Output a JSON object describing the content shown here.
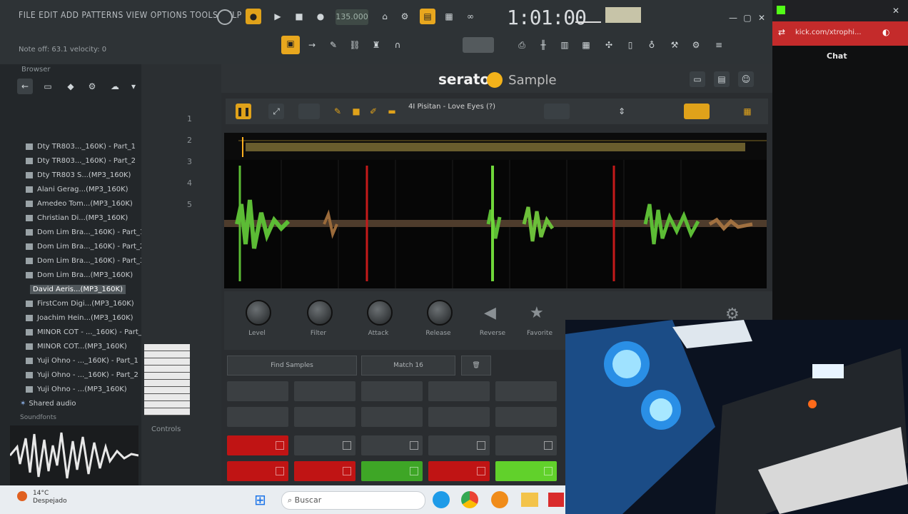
{
  "app": {
    "menu": "FILE EDIT ADD PATTERNS VIEW OPTIONS TOOLS HELP",
    "hint": "Note off: 63.1 velocity: 0",
    "tempo": "135.000",
    "time": "1:01:00"
  },
  "browser": {
    "title": "Browser",
    "items": [
      "Dty TR803..._160K) - Part_1",
      "Dty TR803..._160K) - Part_2",
      "Dty TR803 S...(MP3_160K)",
      "Alani Gerag...(MP3_160K)",
      "Amedeo Tom...(MP3_160K)",
      "Christian Di...(MP3_160K)",
      "Dom Lim Bra..._160K) - Part_1",
      "Dom Lim Bra..._160K) - Part_2",
      "Dom Lim Bra..._160K) - Part_3",
      "Dom Lim Bra...(MP3_160K)",
      "David Aeris...(MP3_160K)",
      "FirstCom Digi...(MP3_160K)",
      "Joachim Hein...(MP3_160K)",
      "MINOR COT - ..._160K) - Part_1",
      "MINOR COT...(MP3_160K)",
      "Yuji Ohno - ..._160K) - Part_1",
      "Yuji Ohno - ..._160K) - Part_2",
      "Yuji Ohno - ...(MP3_160K)"
    ],
    "selected_index": 10,
    "folders": [
      "Shared audio",
      "Soundfonts"
    ]
  },
  "rack": {
    "numbers": [
      "1",
      "2",
      "3",
      "4",
      "5"
    ],
    "controls_label": "Controls"
  },
  "serato": {
    "logo": "serato",
    "logo_sub": "Sample",
    "track": "4I Pisitan - Love Eyes (?)",
    "knob_labels": [
      "Level",
      "Filter",
      "Attack",
      "Release",
      "Reverse",
      "Favorite"
    ],
    "dropdowns": [
      "Find Samples",
      "Match 16"
    ],
    "pads": [
      [
        "",
        "",
        "",
        "",
        ""
      ],
      [
        "",
        "",
        "",
        "",
        ""
      ],
      [
        "red",
        "",
        "",
        "",
        ""
      ],
      [
        "red",
        "red",
        "green",
        "red",
        "lgreen"
      ]
    ]
  },
  "chrome": {
    "url": "kick.com/xtrophi...",
    "chat": "Chat"
  },
  "taskbar": {
    "weather_temp": "14°C",
    "weather_desc": "Despejado",
    "search": "Buscar"
  },
  "colors": {
    "accent_orange": "#f3b21a",
    "pad_red": "#c01414",
    "pad_green": "#3ea626",
    "browser_red": "#c42b2b"
  }
}
